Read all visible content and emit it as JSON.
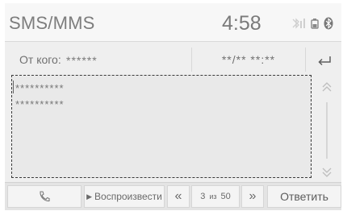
{
  "header": {
    "app_title": "SMS/MMS",
    "clock": "4:58",
    "status_icons": [
      "bluetooth-phone-icon",
      "battery-icon",
      "bluetooth-icon"
    ]
  },
  "message": {
    "from_label": "От кого:",
    "from_value": "******",
    "date_value": "**/** **:**",
    "body_lines": [
      "**********",
      "**********"
    ]
  },
  "controls": {
    "back_icon": "back-arrow-icon",
    "scroll_up_icon": "chevron-up-icon",
    "scroll_down_icon": "chevron-down-icon"
  },
  "bottom_bar": {
    "call_icon": "phone-icon",
    "play_label": "Воспроизвести",
    "prev_label": "«",
    "page_current": "3",
    "page_separator": "из",
    "page_total": "50",
    "next_label": "»",
    "reply_label": "Ответить"
  }
}
